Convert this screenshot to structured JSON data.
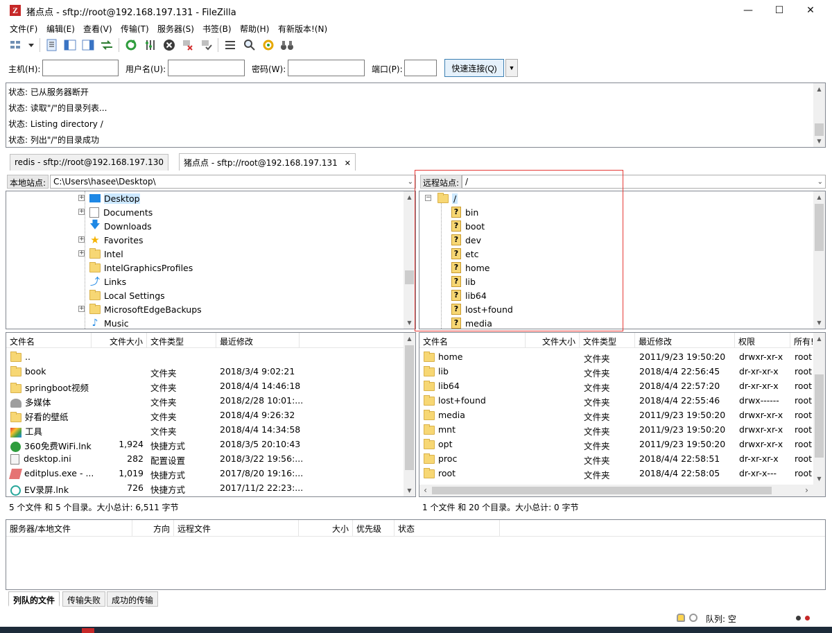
{
  "window": {
    "title": "猪点点 - sftp://root@192.168.197.131 - FileZilla"
  },
  "menu": [
    "文件(F)",
    "编辑(E)",
    "查看(V)",
    "传输(T)",
    "服务器(S)",
    "书签(B)",
    "帮助(H)",
    "有新版本!(N)"
  ],
  "quickconnect": {
    "host_label": "主机(H):",
    "user_label": "用户名(U):",
    "pass_label": "密码(W):",
    "port_label": "端口(P):",
    "host_value": "",
    "user_value": "",
    "pass_value": "",
    "port_value": "",
    "button": "快速连接(Q)"
  },
  "log": [
    "状态: 已从服务器断开",
    "状态: 读取\"/\"的目录列表...",
    "状态: Listing directory /",
    "状态: 列出\"/\"的目录成功"
  ],
  "tabs": [
    {
      "label": "redis - sftp://root@192.168.197.130",
      "active": false
    },
    {
      "label": "猪点点 - sftp://root@192.168.197.131",
      "active": true
    }
  ],
  "local": {
    "site_label": "本地站点:",
    "path": "C:\\Users\\hasee\\Desktop\\",
    "tree": [
      {
        "label": "Desktop",
        "icon": "desktop-folder",
        "expander": true
      },
      {
        "label": "Documents",
        "icon": "documents-folder",
        "expander": true
      },
      {
        "label": "Downloads",
        "icon": "downloads-arrow",
        "expander": false
      },
      {
        "label": "Favorites",
        "icon": "favorites-star",
        "expander": true
      },
      {
        "label": "Intel",
        "icon": "folder",
        "expander": true
      },
      {
        "label": "IntelGraphicsProfiles",
        "icon": "folder",
        "expander": false
      },
      {
        "label": "Links",
        "icon": "links-arrow",
        "expander": false
      },
      {
        "label": "Local Settings",
        "icon": "folder",
        "expander": false
      },
      {
        "label": "MicrosoftEdgeBackups",
        "icon": "folder",
        "expander": true
      },
      {
        "label": "Music",
        "icon": "music-note",
        "expander": false
      }
    ],
    "columns": [
      "文件名",
      "文件大小",
      "文件类型",
      "最近修改"
    ],
    "files": [
      {
        "name": "..",
        "size": "",
        "type": "",
        "modified": "",
        "icon": "folder"
      },
      {
        "name": "book",
        "size": "",
        "type": "文件夹",
        "modified": "2018/3/4 9:02:21",
        "icon": "folder"
      },
      {
        "name": "springboot视频",
        "size": "",
        "type": "文件夹",
        "modified": "2018/4/4 14:46:18",
        "icon": "folder"
      },
      {
        "name": "多媒体",
        "size": "",
        "type": "文件夹",
        "modified": "2018/2/28 10:01:...",
        "icon": "media-drive"
      },
      {
        "name": "好看的壁纸",
        "size": "",
        "type": "文件夹",
        "modified": "2018/4/4 9:26:32",
        "icon": "folder"
      },
      {
        "name": "工具",
        "size": "",
        "type": "文件夹",
        "modified": "2018/4/4 14:34:58",
        "icon": "tools"
      },
      {
        "name": "360免费WiFi.lnk",
        "size": "1,924",
        "type": "快捷方式",
        "modified": "2018/3/5 20:10:43",
        "icon": "wifi"
      },
      {
        "name": "desktop.ini",
        "size": "282",
        "type": "配置设置",
        "modified": "2018/3/22 19:56:...",
        "icon": "ini-file"
      },
      {
        "name": "editplus.exe - ...",
        "size": "1,019",
        "type": "快捷方式",
        "modified": "2017/8/20 19:16:...",
        "icon": "editplus"
      },
      {
        "name": "EV录屏.lnk",
        "size": "726",
        "type": "快捷方式",
        "modified": "2017/11/2 22:23:...",
        "icon": "ev-recorder"
      }
    ],
    "status": "5 个文件 和 5 个目录。大小总计: 6,511 字节"
  },
  "remote": {
    "site_label": "远程站点:",
    "path": "/",
    "root": "/",
    "tree": [
      "bin",
      "boot",
      "dev",
      "etc",
      "home",
      "lib",
      "lib64",
      "lost+found",
      "media"
    ],
    "columns": [
      "文件名",
      "文件大小",
      "文件类型",
      "最近修改",
      "权限",
      "所有者"
    ],
    "column_owner_visible": "所有!",
    "files": [
      {
        "name": "home",
        "type": "文件夹",
        "modified": "2011/9/23 19:50:20",
        "perm": "drwxr-xr-x",
        "owner": "root"
      },
      {
        "name": "lib",
        "type": "文件夹",
        "modified": "2018/4/4 22:56:45",
        "perm": "dr-xr-xr-x",
        "owner": "root"
      },
      {
        "name": "lib64",
        "type": "文件夹",
        "modified": "2018/4/4 22:57:20",
        "perm": "dr-xr-xr-x",
        "owner": "root"
      },
      {
        "name": "lost+found",
        "type": "文件夹",
        "modified": "2018/4/4 22:55:46",
        "perm": "drwx------",
        "owner": "root"
      },
      {
        "name": "media",
        "type": "文件夹",
        "modified": "2011/9/23 19:50:20",
        "perm": "drwxr-xr-x",
        "owner": "root"
      },
      {
        "name": "mnt",
        "type": "文件夹",
        "modified": "2011/9/23 19:50:20",
        "perm": "drwxr-xr-x",
        "owner": "root"
      },
      {
        "name": "opt",
        "type": "文件夹",
        "modified": "2011/9/23 19:50:20",
        "perm": "drwxr-xr-x",
        "owner": "root"
      },
      {
        "name": "proc",
        "type": "文件夹",
        "modified": "2018/4/4 22:58:51",
        "perm": "dr-xr-xr-x",
        "owner": "root"
      },
      {
        "name": "root",
        "type": "文件夹",
        "modified": "2018/4/4 22:58:05",
        "perm": "dr-xr-x---",
        "owner": "root"
      }
    ],
    "status": "1 个文件 和 20 个目录。大小总计: 0 字节"
  },
  "queue": {
    "columns": [
      "服务器/本地文件",
      "方向",
      "远程文件",
      "大小",
      "优先级",
      "状态"
    ],
    "tabs": [
      "列队的文件",
      "传输失败",
      "成功的传输"
    ]
  },
  "statusbar": {
    "queue": "队列: 空"
  },
  "colors": {
    "highlight_box": "#e53935",
    "folder": "#f7d774"
  }
}
